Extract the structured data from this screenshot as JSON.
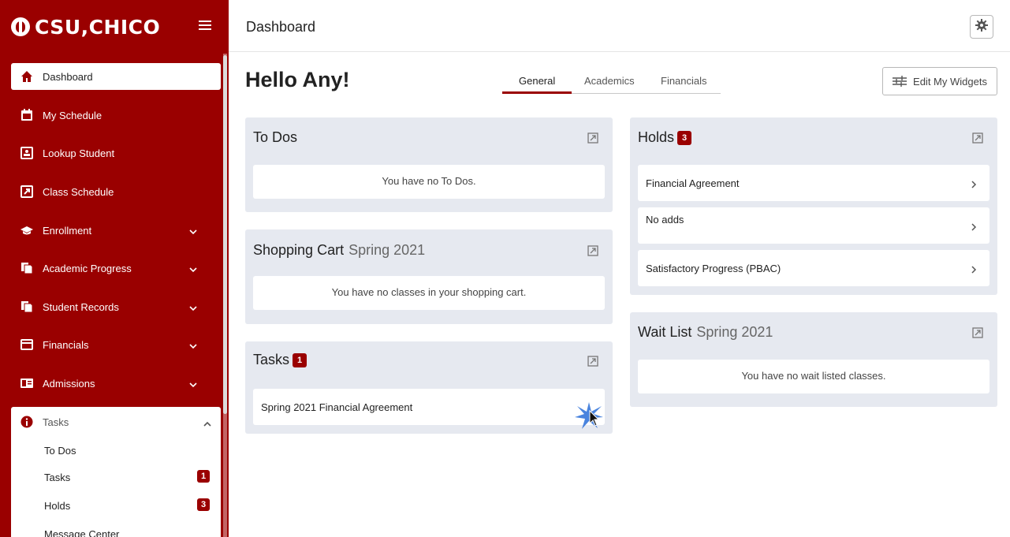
{
  "brand": {
    "name": "CSU,CHICO"
  },
  "header": {
    "title": "Dashboard"
  },
  "greeting": "Hello Any!",
  "tabs": [
    {
      "label": "General",
      "active": true
    },
    {
      "label": "Academics",
      "active": false
    },
    {
      "label": "Financials",
      "active": false
    }
  ],
  "edit_widgets_label": "Edit My Widgets",
  "sidebar": {
    "items": [
      {
        "label": "Dashboard",
        "icon": "home-icon",
        "active": true
      },
      {
        "label": "My Schedule",
        "icon": "calendar-icon"
      },
      {
        "label": "Lookup Student",
        "icon": "id-card-icon"
      },
      {
        "label": "Class Schedule",
        "icon": "external-square-icon"
      },
      {
        "label": "Enrollment",
        "icon": "graduation-cap-icon",
        "expandable": true
      },
      {
        "label": "Academic Progress",
        "icon": "documents-icon",
        "expandable": true
      },
      {
        "label": "Student Records",
        "icon": "documents-icon",
        "expandable": true
      },
      {
        "label": "Financials",
        "icon": "credit-card-icon",
        "expandable": true
      },
      {
        "label": "Admissions",
        "icon": "newspaper-icon",
        "expandable": true
      }
    ],
    "tasks_group": {
      "label": "Tasks",
      "icon": "info-circle-icon",
      "expanded": true,
      "children": [
        {
          "label": "To Dos",
          "badge": ""
        },
        {
          "label": "Tasks",
          "badge": "1"
        },
        {
          "label": "Holds",
          "badge": "3"
        },
        {
          "label": "Message Center",
          "badge": ""
        }
      ]
    }
  },
  "widgets": {
    "todos": {
      "title": "To Dos",
      "empty": "You have no To Dos."
    },
    "cart": {
      "title": "Shopping Cart",
      "term": "Spring 2021",
      "empty": "You have no classes in your shopping cart."
    },
    "tasks": {
      "title": "Tasks",
      "badge": "1",
      "items": [
        "Spring 2021 Financial Agreement"
      ]
    },
    "holds": {
      "title": "Holds",
      "badge": "3",
      "items": [
        "Financial Agreement",
        "No adds",
        "Satisfactory Progress (PBAC)"
      ]
    },
    "waitlist": {
      "title": "Wait List",
      "term": "Spring 2021",
      "empty": "You have no wait listed classes."
    }
  },
  "colors": {
    "brand": "#9a0000",
    "widget_bg": "#e6e9f0"
  }
}
